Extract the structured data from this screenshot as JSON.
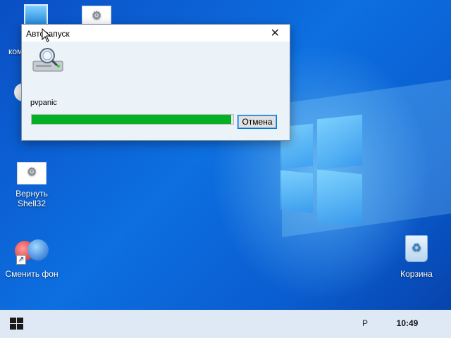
{
  "desktop": {
    "icons": [
      {
        "label": "ком"
      },
      {
        "label": ""
      },
      {
        "label": "Вернуть Shell32"
      },
      {
        "label": "Сменить фон"
      },
      {
        "label": "Корзина"
      }
    ]
  },
  "dialog": {
    "title": "Автозапуск",
    "close_icon": "close-icon",
    "item_name": "pvpanic",
    "progress_fraction": 0.99,
    "cancel_label": "Отмена"
  },
  "taskbar": {
    "tray_char": "Р",
    "clock": "10:49"
  },
  "colors": {
    "progress": "#06b025",
    "desktop": "#0d6fe0"
  }
}
